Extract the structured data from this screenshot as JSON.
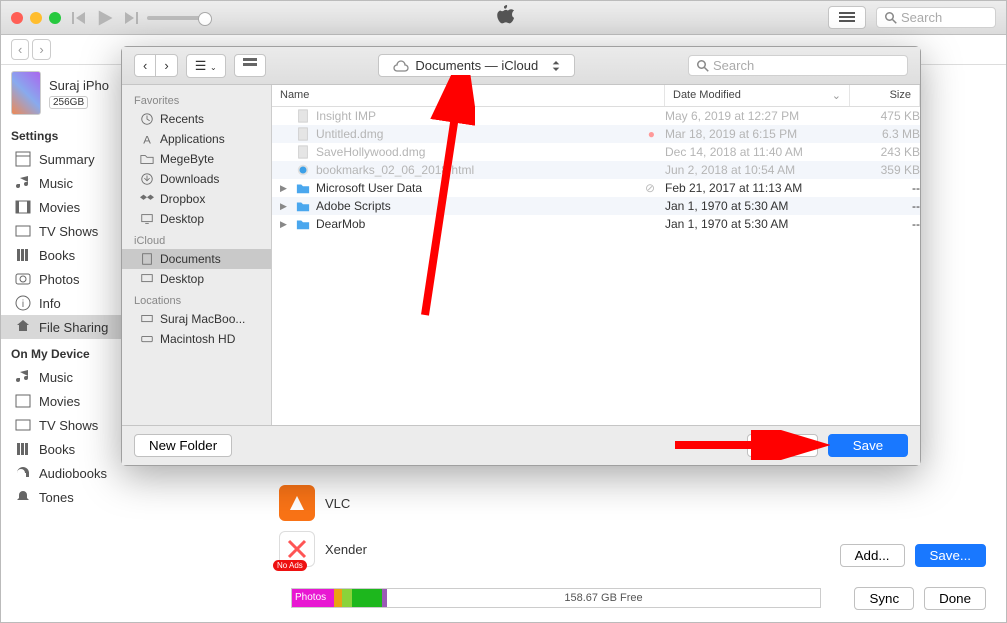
{
  "titlebar": {
    "search_placeholder": "Search"
  },
  "device": {
    "name": "Suraj iPho",
    "capacity": "256GB"
  },
  "settings_header": "Settings",
  "settings": [
    {
      "label": "Summary"
    },
    {
      "label": "Music"
    },
    {
      "label": "Movies"
    },
    {
      "label": "TV Shows"
    },
    {
      "label": "Books"
    },
    {
      "label": "Photos"
    },
    {
      "label": "Info"
    },
    {
      "label": "File Sharing"
    }
  ],
  "onmydevice_header": "On My Device",
  "onmydevice": [
    {
      "label": "Music"
    },
    {
      "label": "Movies"
    },
    {
      "label": "TV Shows"
    },
    {
      "label": "Books"
    },
    {
      "label": "Audiobooks"
    },
    {
      "label": "Tones"
    }
  ],
  "apps": [
    {
      "name": "VLC"
    },
    {
      "name": "Xender",
      "badge": "No Ads"
    }
  ],
  "add_label": "Add...",
  "saveellipsis_label": "Save...",
  "sync_label": "Sync",
  "done_label": "Done",
  "storage": {
    "photos_label": "Photos",
    "free": "158.67 GB Free"
  },
  "sheet": {
    "search_placeholder": "Search",
    "location": "Documents — iCloud",
    "favorites_header": "Favorites",
    "favorites": [
      {
        "label": "Recents"
      },
      {
        "label": "Applications"
      },
      {
        "label": "MegeByte"
      },
      {
        "label": "Downloads"
      },
      {
        "label": "Dropbox"
      },
      {
        "label": "Desktop"
      }
    ],
    "icloud_header": "iCloud",
    "icloud": [
      {
        "label": "Documents"
      },
      {
        "label": "Desktop"
      }
    ],
    "locations_header": "Locations",
    "locations": [
      {
        "label": "Suraj MacBoo..."
      },
      {
        "label": "Macintosh HD"
      }
    ],
    "cols": {
      "name": "Name",
      "date": "Date Modified",
      "size": "Size"
    },
    "files": [
      {
        "name": "Insight IMP",
        "date": "May 6, 2019 at 12:27 PM",
        "size": "475 KB",
        "dim": true
      },
      {
        "name": "Untitled.dmg",
        "date": "Mar 18, 2019 at 6:15 PM",
        "size": "6.3 MB",
        "dim": true,
        "dot": true
      },
      {
        "name": "SaveHollywood.dmg",
        "date": "Dec 14, 2018 at 11:40 AM",
        "size": "243 KB",
        "dim": true
      },
      {
        "name": "bookmarks_02_06_2018.html",
        "date": "Jun 2, 2018 at 10:54 AM",
        "size": "359 KB",
        "dim": true,
        "safari": true
      },
      {
        "name": "Microsoft User Data",
        "date": "Feb 21, 2017 at 11:13 AM",
        "size": "--",
        "folder": true,
        "slash": true
      },
      {
        "name": "Adobe Scripts",
        "date": "Jan 1, 1970 at 5:30 AM",
        "size": "--",
        "folder": true
      },
      {
        "name": "DearMob",
        "date": "Jan 1, 1970 at 5:30 AM",
        "size": "--",
        "folder": true
      }
    ],
    "newfolder": "New Folder",
    "cancel": "Cancel",
    "save": "Save"
  }
}
